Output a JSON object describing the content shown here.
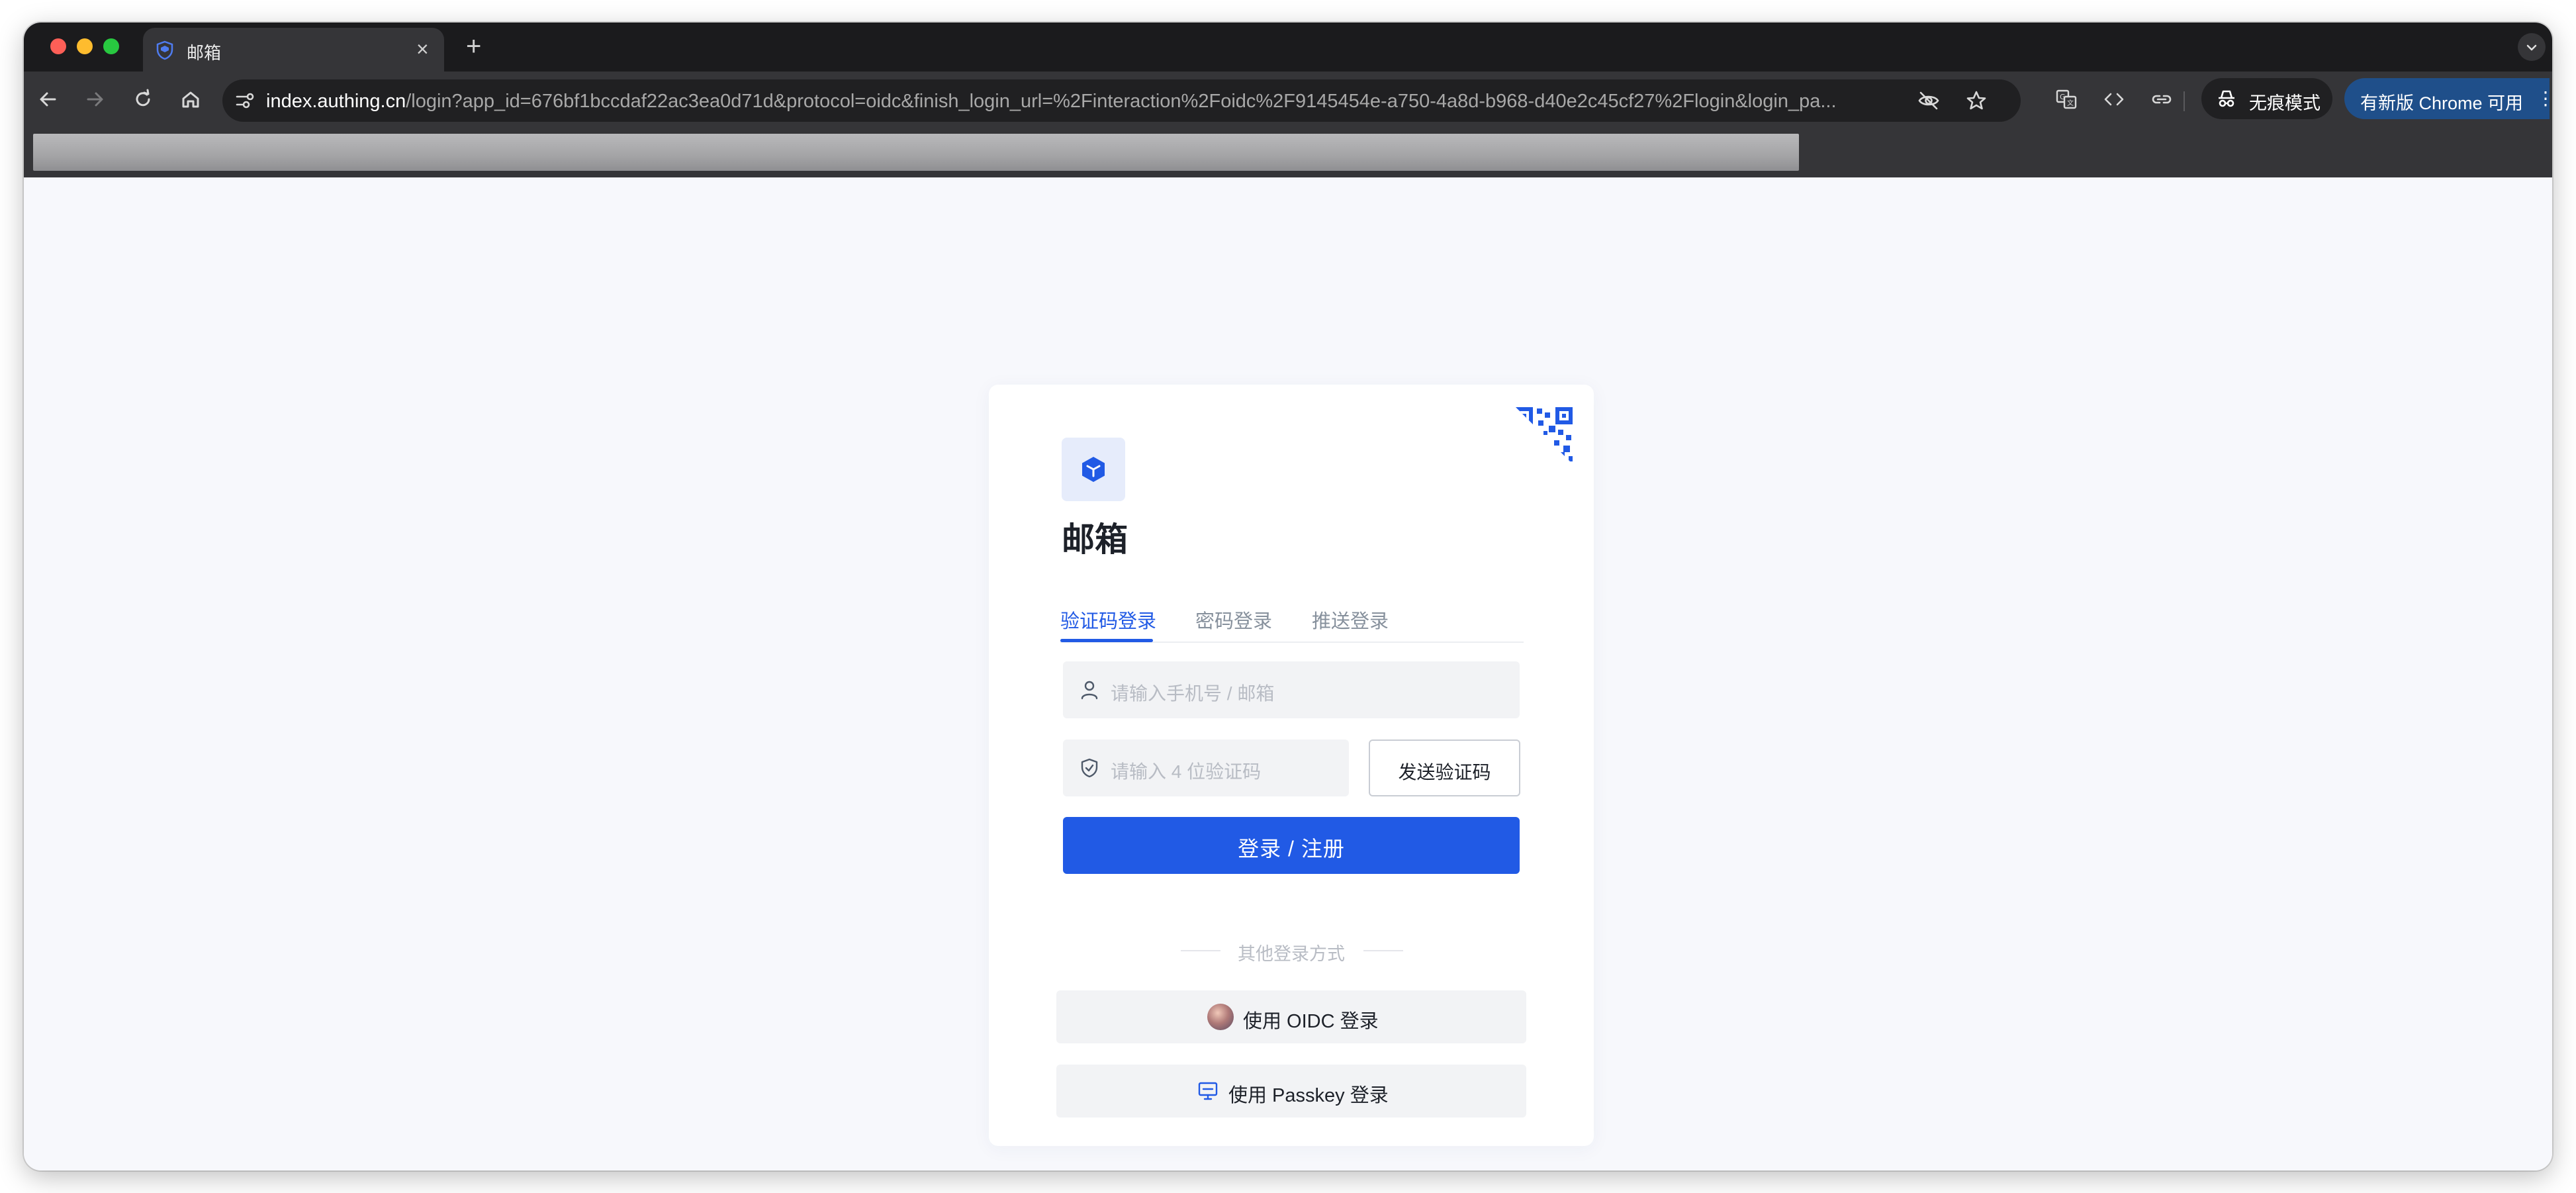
{
  "browser": {
    "tab": {
      "title": "邮箱"
    },
    "url": {
      "host": "index.authing.cn",
      "rest": "/login?app_id=676bf1bccdaf22ac3ea0d71d&protocol=oidc&finish_login_url=%2Finteraction%2Foidc%2F9145454e-a750-4a8d-b968-d40e2c45cf27%2Flogin&login_pa..."
    },
    "incognito_label": "无痕模式",
    "update_label": "有新版 Chrome 可用",
    "icons": [
      "back-icon",
      "forward-icon",
      "reload-icon",
      "home-icon",
      "site-settings-icon",
      "eye-off-icon",
      "star-icon",
      "translate-icon",
      "code-icon",
      "link-icon",
      "incognito-icon",
      "more-icon"
    ]
  },
  "login": {
    "app_name": "邮箱",
    "tabs": [
      {
        "label": "验证码登录",
        "active": true
      },
      {
        "label": "密码登录",
        "active": false
      },
      {
        "label": "推送登录",
        "active": false
      }
    ],
    "account_placeholder": "请输入手机号 / 邮箱",
    "code_placeholder": "请输入 4 位验证码",
    "send_code_label": "发送验证码",
    "submit_label": "登录 / 注册",
    "other_methods_label": "其他登录方式",
    "oidc_label": "使用 OIDC 登录",
    "passkey_label": "使用 Passkey 登录"
  },
  "colors": {
    "primary": "#215ae5",
    "page_bg": "#f7f8fc",
    "chrome_dark": "#1b1b1d",
    "chrome_toolbar": "#353538"
  }
}
